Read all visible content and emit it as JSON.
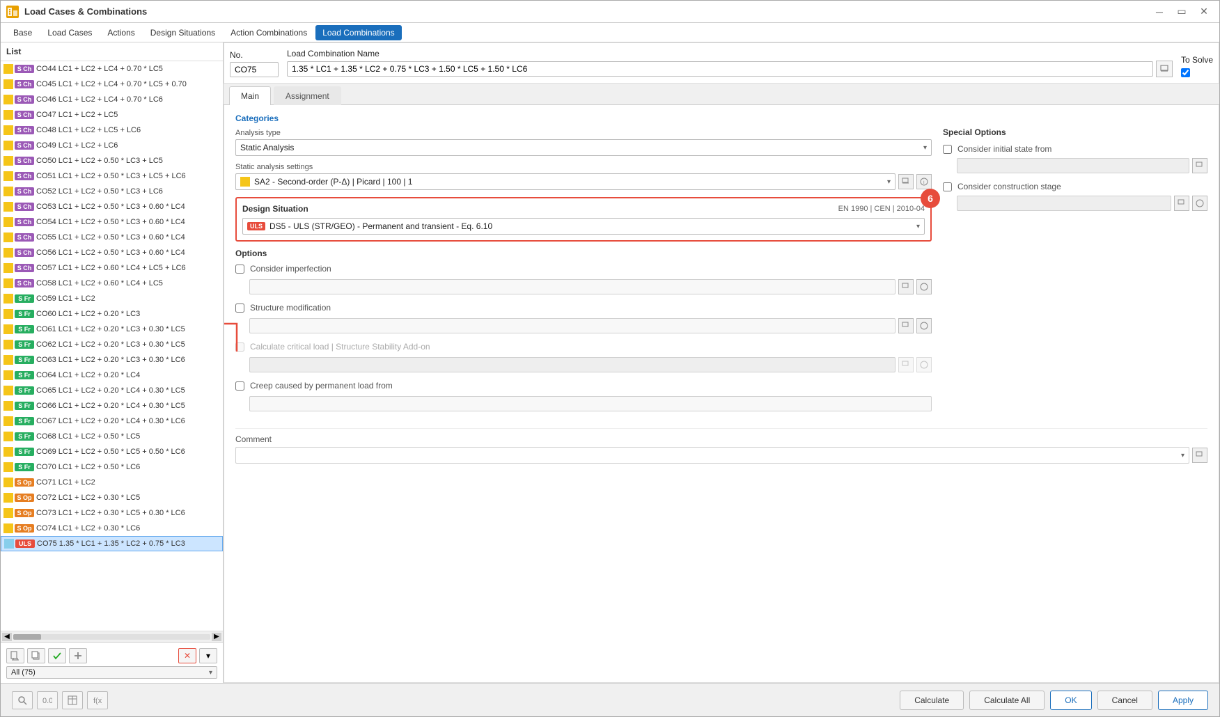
{
  "window": {
    "title": "Load Cases & Combinations",
    "icon": "LC"
  },
  "menu": {
    "items": [
      "Base",
      "Load Cases",
      "Actions",
      "Design Situations",
      "Action Combinations",
      "Load Combinations"
    ],
    "active": "Load Combinations"
  },
  "list": {
    "header": "List",
    "items": [
      {
        "id": "CO44",
        "badge": "S Ch",
        "badge_class": "badge-sch",
        "text": "CO44 LC1 + LC2 + LC4 + 0.70 * LC5",
        "color": "#f5c518"
      },
      {
        "id": "CO45",
        "badge": "S Ch",
        "badge_class": "badge-sch",
        "text": "CO45 LC1 + LC2 + LC4 + 0.70 * LC5 + 0.70",
        "color": "#f5c518"
      },
      {
        "id": "CO46",
        "badge": "S Ch",
        "badge_class": "badge-sch",
        "text": "CO46 LC1 + LC2 + LC4 + 0.70 * LC6",
        "color": "#f5c518"
      },
      {
        "id": "CO47",
        "badge": "S Ch",
        "badge_class": "badge-sch",
        "text": "CO47 LC1 + LC2 + LC5",
        "color": "#f5c518"
      },
      {
        "id": "CO48",
        "badge": "S Ch",
        "badge_class": "badge-sch",
        "text": "CO48 LC1 + LC2 + LC5 + LC6",
        "color": "#f5c518"
      },
      {
        "id": "CO49",
        "badge": "S Ch",
        "badge_class": "badge-sch",
        "text": "CO49 LC1 + LC2 + LC6",
        "color": "#f5c518"
      },
      {
        "id": "CO50",
        "badge": "S Ch",
        "badge_class": "badge-sch",
        "text": "CO50 LC1 + LC2 + 0.50 * LC3 + LC5",
        "color": "#f5c518"
      },
      {
        "id": "CO51",
        "badge": "S Ch",
        "badge_class": "badge-sch",
        "text": "CO51 LC1 + LC2 + 0.50 * LC3 + LC5 + LC6",
        "color": "#f5c518"
      },
      {
        "id": "CO52",
        "badge": "S Ch",
        "badge_class": "badge-sch",
        "text": "CO52 LC1 + LC2 + 0.50 * LC3 + LC6",
        "color": "#f5c518"
      },
      {
        "id": "CO53",
        "badge": "S Ch",
        "badge_class": "badge-sch",
        "text": "CO53 LC1 + LC2 + 0.50 * LC3 + 0.60 * LC4",
        "color": "#f5c518"
      },
      {
        "id": "CO54",
        "badge": "S Ch",
        "badge_class": "badge-sch",
        "text": "CO54 LC1 + LC2 + 0.50 * LC3 + 0.60 * LC4",
        "color": "#f5c518"
      },
      {
        "id": "CO55",
        "badge": "S Ch",
        "badge_class": "badge-sch",
        "text": "CO55 LC1 + LC2 + 0.50 * LC3 + 0.60 * LC4",
        "color": "#f5c518"
      },
      {
        "id": "CO56",
        "badge": "S Ch",
        "badge_class": "badge-sch",
        "text": "CO56 LC1 + LC2 + 0.50 * LC3 + 0.60 * LC4",
        "color": "#f5c518"
      },
      {
        "id": "CO57",
        "badge": "S Ch",
        "badge_class": "badge-sch",
        "text": "CO57 LC1 + LC2 + 0.60 * LC4 + LC5 + LC6",
        "color": "#f5c518"
      },
      {
        "id": "CO58",
        "badge": "S Ch",
        "badge_class": "badge-sch",
        "text": "CO58 LC1 + LC2 + 0.60 * LC4 + LC5",
        "color": "#f5c518"
      },
      {
        "id": "CO59",
        "badge": "S Fr",
        "badge_class": "badge-sfr",
        "text": "CO59 LC1 + LC2",
        "color": "#f5c518"
      },
      {
        "id": "CO60",
        "badge": "S Fr",
        "badge_class": "badge-sfr",
        "text": "CO60 LC1 + LC2 + 0.20 * LC3",
        "color": "#f5c518"
      },
      {
        "id": "CO61",
        "badge": "S Fr",
        "badge_class": "badge-sfr",
        "text": "CO61 LC1 + LC2 + 0.20 * LC3 + 0.30 * LC5",
        "color": "#f5c518"
      },
      {
        "id": "CO62",
        "badge": "S Fr",
        "badge_class": "badge-sfr",
        "text": "CO62 LC1 + LC2 + 0.20 * LC3 + 0.30 * LC5",
        "color": "#f5c518"
      },
      {
        "id": "CO63",
        "badge": "S Fr",
        "badge_class": "badge-sfr",
        "text": "CO63 LC1 + LC2 + 0.20 * LC3 + 0.30 * LC6",
        "color": "#f5c518"
      },
      {
        "id": "CO64",
        "badge": "S Fr",
        "badge_class": "badge-sfr",
        "text": "CO64 LC1 + LC2 + 0.20 * LC4",
        "color": "#f5c518"
      },
      {
        "id": "CO65",
        "badge": "S Fr",
        "badge_class": "badge-sfr",
        "text": "CO65 LC1 + LC2 + 0.20 * LC4 + 0.30 * LC5",
        "color": "#f5c518"
      },
      {
        "id": "CO66",
        "badge": "S Fr",
        "badge_class": "badge-sfr",
        "text": "CO66 LC1 + LC2 + 0.20 * LC4 + 0.30 * LC5",
        "color": "#f5c518"
      },
      {
        "id": "CO67",
        "badge": "S Fr",
        "badge_class": "badge-sfr",
        "text": "CO67 LC1 + LC2 + 0.20 * LC4 + 0.30 * LC6",
        "color": "#f5c518"
      },
      {
        "id": "CO68",
        "badge": "S Fr",
        "badge_class": "badge-sfr",
        "text": "CO68 LC1 + LC2 + 0.50 * LC5",
        "color": "#f5c518"
      },
      {
        "id": "CO69",
        "badge": "S Fr",
        "badge_class": "badge-sfr",
        "text": "CO69 LC1 + LC2 + 0.50 * LC5 + 0.50 * LC6",
        "color": "#f5c518"
      },
      {
        "id": "CO70",
        "badge": "S Fr",
        "badge_class": "badge-sfr",
        "text": "CO70 LC1 + LC2 + 0.50 * LC6",
        "color": "#f5c518"
      },
      {
        "id": "CO71",
        "badge": "S Op",
        "badge_class": "badge-sop",
        "text": "CO71 LC1 + LC2",
        "color": "#f5c518"
      },
      {
        "id": "CO72",
        "badge": "S Op",
        "badge_class": "badge-sop",
        "text": "CO72 LC1 + LC2 + 0.30 * LC5",
        "color": "#f5c518"
      },
      {
        "id": "CO73",
        "badge": "S Op",
        "badge_class": "badge-sop",
        "text": "CO73 LC1 + LC2 + 0.30 * LC5 + 0.30 * LC6",
        "color": "#f5c518"
      },
      {
        "id": "CO74",
        "badge": "S Op",
        "badge_class": "badge-sop",
        "text": "CO74 LC1 + LC2 + 0.30 * LC6",
        "color": "#f5c518"
      },
      {
        "id": "CO75",
        "badge": "ULS",
        "badge_class": "badge-uls",
        "text": "CO75 1.35 * LC1 + 1.35 * LC2 + 0.75 * LC3",
        "color": "#87ceeb",
        "selected": true
      }
    ],
    "filter": "All (75)"
  },
  "form": {
    "no_label": "No.",
    "no_value": "CO75",
    "name_label": "Load Combination Name",
    "name_value": "1.35 * LC1 + 1.35 * LC2 + 0.75 * LC3 + 1.50 * LC5 + 1.50 * LC6",
    "to_solve_label": "To Solve",
    "to_solve_checked": true
  },
  "tabs": {
    "items": [
      "Main",
      "Assignment"
    ],
    "active": "Main"
  },
  "main_tab": {
    "categories_title": "Categories",
    "analysis_type_label": "Analysis type",
    "analysis_type_value": "Static Analysis",
    "static_settings_label": "Static analysis settings",
    "static_settings_value": "SA2 - Second-order (P-Δ) | Picard | 100 | 1",
    "design_situation_title": "Design Situation",
    "design_situation_standard": "EN 1990 | CEN | 2010-04",
    "design_situation_value": "DS5 - ULS (STR/GEO) - Permanent and transient - Eq. 6.10",
    "design_situation_badge": "ULS",
    "step_number": "6",
    "options_title": "Options",
    "consider_imperfection": "Consider imperfection",
    "structure_modification": "Structure modification",
    "calculate_critical": "Calculate critical load | Structure Stability Add-on",
    "creep_caused": "Creep caused by permanent load from",
    "special_options_title": "Special Options",
    "consider_initial_state": "Consider initial state from",
    "consider_construction": "Consider construction stage",
    "comment_label": "Comment"
  },
  "bottom": {
    "calculate_label": "Calculate",
    "calculate_all_label": "Calculate All",
    "ok_label": "OK",
    "cancel_label": "Cancel",
    "apply_label": "Apply"
  }
}
